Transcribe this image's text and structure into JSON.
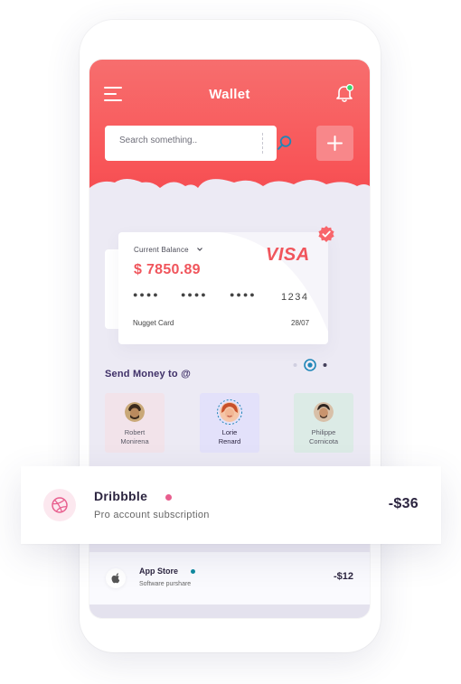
{
  "header": {
    "title": "Wallet",
    "search_placeholder": "Search something.."
  },
  "card": {
    "balance_label": "Current Balance",
    "balance": "$ 7850.89",
    "brand": "VISA",
    "number_groups": [
      "●●●●",
      "●●●●",
      "●●●●"
    ],
    "last4": "1234",
    "card_name": "Nugget Card",
    "expiry": "28/07"
  },
  "carousel": {
    "total": 3,
    "active": 2
  },
  "send_money": {
    "title": "Send Money to @",
    "contacts": [
      {
        "name_line1": "Robert",
        "name_line2": "Monirena",
        "bg": "#f2e3ea"
      },
      {
        "name_line1": "Lorie",
        "name_line2": "Renard",
        "bg": "#e3e1fa"
      },
      {
        "name_line1": "Philippe",
        "name_line2": "Cornicota",
        "bg": "#dcebe6"
      }
    ]
  },
  "transactions": {
    "featured": {
      "name": "Dribbble",
      "description": "Pro account subscription",
      "amount": "-$36",
      "icon": "dribbble-icon",
      "dot_color": "#e85e8e"
    },
    "list": [
      {
        "name": "App Store",
        "description": "Software purshare",
        "amount": "-$12",
        "icon": "apple-icon",
        "dot_color": "#0f8aa0"
      }
    ]
  },
  "colors": {
    "accent": "#f85457",
    "accent_light": "#f8878a",
    "notification_dot": "#3ad46b",
    "heading": "#3f3068"
  }
}
